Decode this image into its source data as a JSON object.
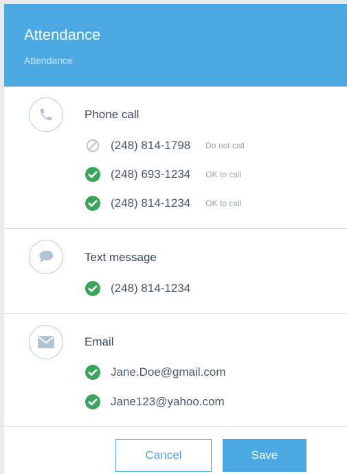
{
  "header": {
    "title": "Attendance",
    "subtitle": "Attendance"
  },
  "colors": {
    "accent": "#4aa9e3",
    "ok": "#3aa35c",
    "blocked": "#c3c7cc",
    "icon_circle_border": "#b8c7d6"
  },
  "sections": [
    {
      "title": "Phone call",
      "icon": "phone-icon",
      "entries": [
        {
          "value": "(248) 814-1798",
          "status": "Do not call",
          "status_icon": "no-entry-icon"
        },
        {
          "value": "(248) 693-1234",
          "status": "OK to call",
          "status_icon": "check-circle-icon"
        },
        {
          "value": "(248) 814-1234",
          "status": "OK to call",
          "status_icon": "check-circle-icon"
        }
      ]
    },
    {
      "title": "Text message",
      "icon": "speech-bubble-icon",
      "entries": [
        {
          "value": "(248) 814-1234",
          "status_icon": "check-circle-icon"
        }
      ]
    },
    {
      "title": "Email",
      "icon": "envelope-icon",
      "entries": [
        {
          "value": "Jane.Doe@gmail.com",
          "status_icon": "check-circle-icon"
        },
        {
          "value": "Jane123@yahoo.com",
          "status_icon": "check-circle-icon"
        }
      ]
    }
  ],
  "actions": {
    "cancel_label": "Cancel",
    "save_label": "Save"
  }
}
